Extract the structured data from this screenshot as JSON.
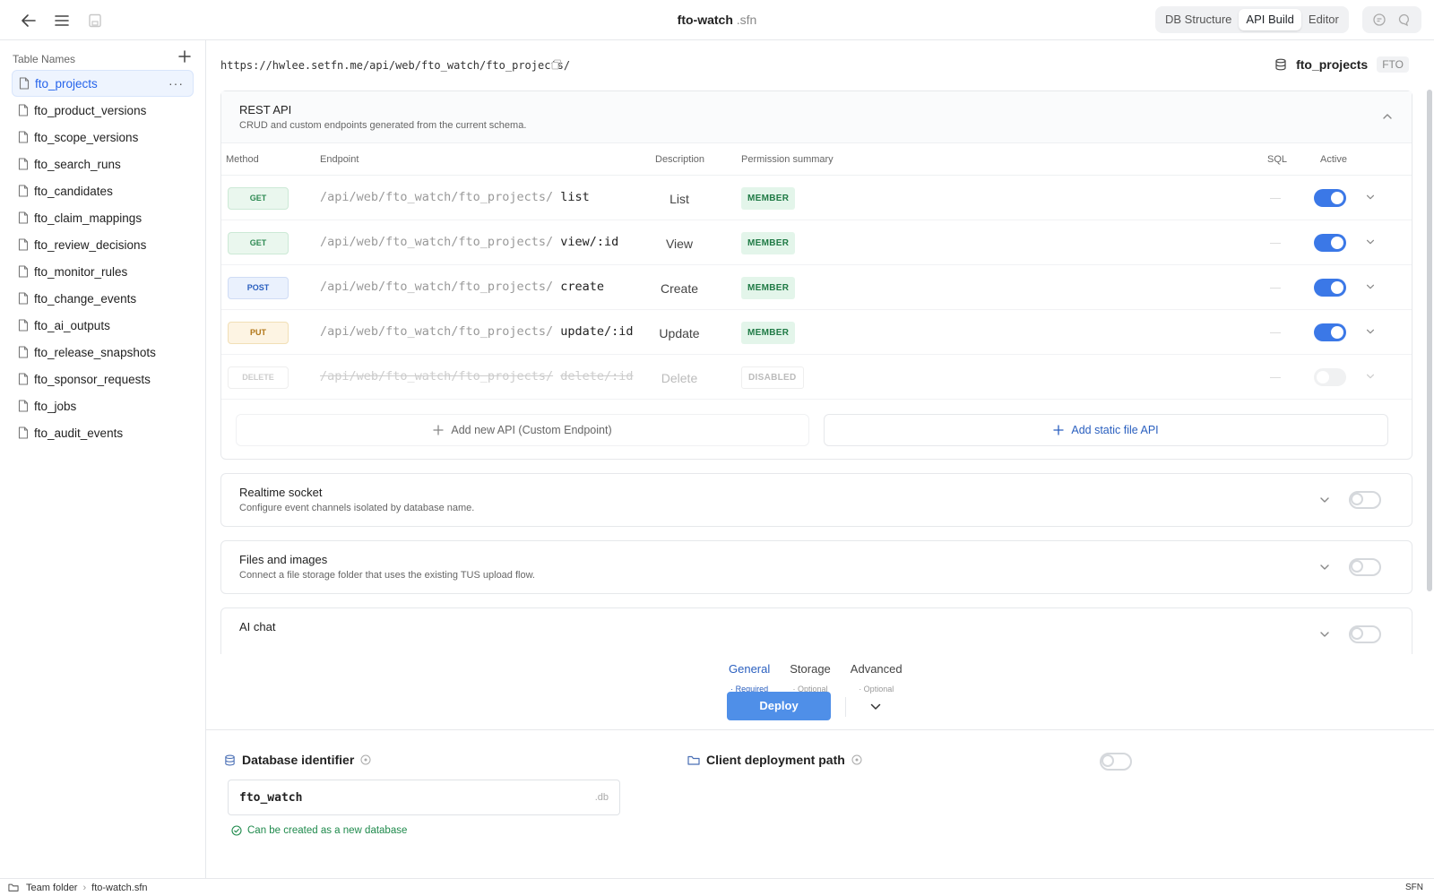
{
  "window": {
    "title": "fto-watch",
    "title_ext": ".sfn"
  },
  "view_tabs": [
    {
      "label": "DB Structure",
      "active": false
    },
    {
      "label": "API Build",
      "active": true
    },
    {
      "label": "Editor",
      "active": false
    }
  ],
  "sidebar": {
    "heading": "Table Names",
    "tables": [
      {
        "label": "fto_projects",
        "selected": true
      },
      {
        "label": "fto_product_versions"
      },
      {
        "label": "fto_scope_versions"
      },
      {
        "label": "fto_search_runs"
      },
      {
        "label": "fto_candidates"
      },
      {
        "label": "fto_claim_mappings"
      },
      {
        "label": "fto_review_decisions"
      },
      {
        "label": "fto_monitor_rules"
      },
      {
        "label": "fto_change_events"
      },
      {
        "label": "fto_ai_outputs"
      },
      {
        "label": "fto_release_snapshots"
      },
      {
        "label": "fto_sponsor_requests"
      },
      {
        "label": "fto_jobs"
      },
      {
        "label": "fto_audit_events"
      }
    ],
    "more_glyph": "···"
  },
  "main": {
    "url": "https://hwlee.setfn.me/api/web/fto_watch/fto_projects/",
    "table_name": "fto_projects",
    "table_tag": "FTO",
    "rest": {
      "title": "REST API",
      "desc": "CRUD and custom endpoints generated from the current schema.",
      "columns": {
        "method": "Method",
        "endpoint": "Endpoint",
        "description": "Description",
        "permission": "Permission summary",
        "sql": "SQL",
        "active": "Active"
      },
      "endpoints": [
        {
          "method": "GET",
          "prefix": "/api/web/fto_watch/fto_projects/",
          "suffix": "list",
          "desc": "List",
          "perm": "MEMBER",
          "active": true
        },
        {
          "method": "GET",
          "prefix": "/api/web/fto_watch/fto_projects/",
          "suffix": "view/:id",
          "desc": "View",
          "perm": "MEMBER",
          "active": true
        },
        {
          "method": "POST",
          "prefix": "/api/web/fto_watch/fto_projects/",
          "suffix": "create",
          "desc": "Create",
          "perm": "MEMBER",
          "active": true
        },
        {
          "method": "PUT",
          "prefix": "/api/web/fto_watch/fto_projects/",
          "suffix": "update/:id",
          "desc": "Update",
          "perm": "MEMBER",
          "active": true
        },
        {
          "method": "DELETE",
          "prefix": "/api/web/fto_watch/fto_projects/",
          "suffix": "delete/:id",
          "desc": "Delete",
          "perm": "DISABLED",
          "active": false
        }
      ],
      "add_custom": "Add new API (Custom Endpoint)",
      "add_static": "Add static file API"
    },
    "realtime": {
      "title": "Realtime socket",
      "desc": "Configure event channels isolated by database name.",
      "enabled": false
    },
    "files": {
      "title": "Files and images",
      "desc": "Connect a file storage folder that uses the existing TUS upload flow.",
      "enabled": false
    },
    "ai": {
      "title": "AI chat",
      "enabled": false
    }
  },
  "deploy": {
    "tabs": [
      {
        "label": "General",
        "sub": "· Required",
        "active": true
      },
      {
        "label": "Storage",
        "sub": "· Optional",
        "active": false
      },
      {
        "label": "Advanced",
        "sub": "· Optional",
        "active": false
      }
    ],
    "button": "Deploy",
    "db_label": "Database identifier",
    "db_value": "fto_watch",
    "db_suffix": ".db",
    "db_status": "Can be created as a new database",
    "client_label": "Client deployment path",
    "client_enabled": false
  },
  "statusbar": {
    "folder": "Team folder",
    "file": "fto-watch.sfn",
    "right": "SFN"
  },
  "colors": {
    "accent": "#3b78e7",
    "get": "#2d8a52",
    "post": "#2a5fbf",
    "put": "#b07516",
    "success": "#1f8a4c"
  }
}
